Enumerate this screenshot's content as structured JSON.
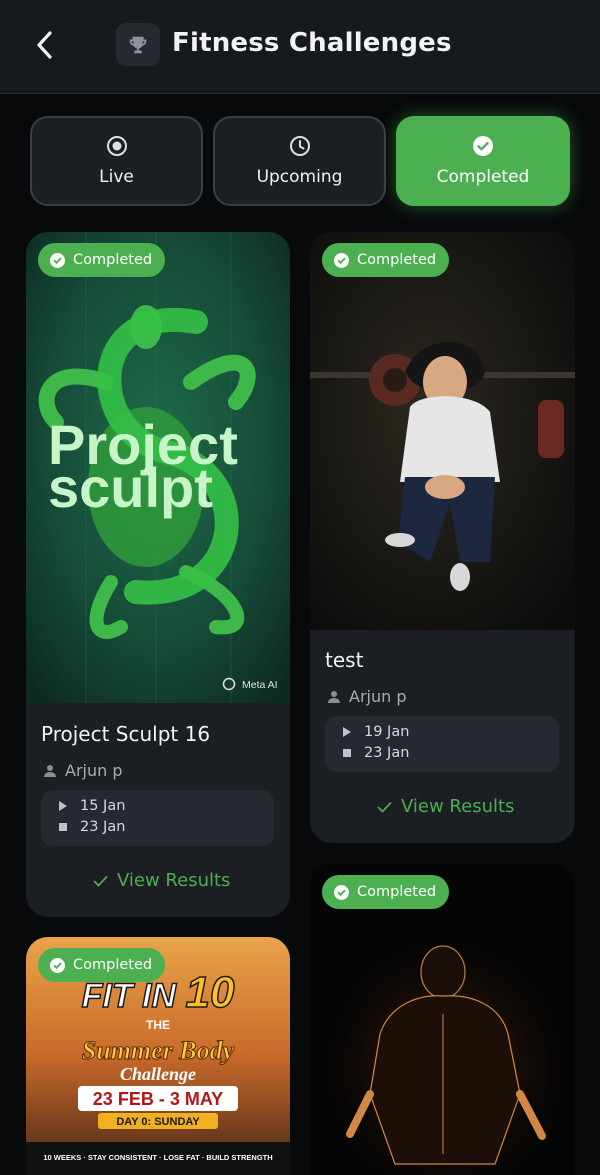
{
  "header": {
    "title": "Fitness Challenges",
    "back_icon": "chevron-left-icon",
    "trophy_icon": "trophy-icon"
  },
  "tabs": [
    {
      "label": "Live",
      "icon": "radio-icon",
      "active": false
    },
    {
      "label": "Upcoming",
      "icon": "clock-icon",
      "active": false
    },
    {
      "label": "Completed",
      "icon": "check-circle-icon",
      "active": true
    }
  ],
  "colors": {
    "accent": "#4caf50",
    "background": "#07090b",
    "card": "#1b1e22"
  },
  "cards": [
    {
      "badge": "Completed",
      "image_text_line1": "Project",
      "image_text_line2": "sculpt",
      "watermark": "Meta AI",
      "name": "Project Sculpt 16",
      "owner": "Arjun p",
      "start": "15 Jan",
      "end": "23 Jan",
      "action": "View Results"
    },
    {
      "badge": "Completed",
      "name": "test",
      "owner": "Arjun p",
      "start": "19 Jan",
      "end": "23 Jan",
      "action": "View Results"
    },
    {
      "badge": "Completed",
      "poster_line1": "FIT IN",
      "poster_number": "10",
      "poster_line2": "THE",
      "poster_line3": "Summer Body",
      "poster_line4": "Challenge",
      "poster_dates": "23 FEB - 3 MAY",
      "poster_day": "DAY 0: SUNDAY",
      "poster_footer": "10 WEEKS · STAY CONSISTENT · LOSE FAT · BUILD STRENGTH"
    },
    {
      "badge": "Completed"
    }
  ]
}
